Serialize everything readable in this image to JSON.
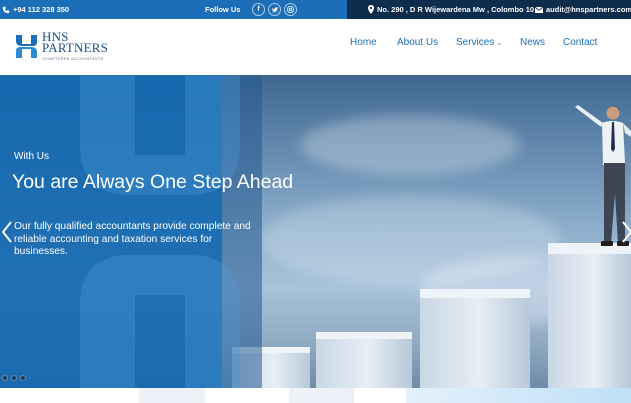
{
  "topbar": {
    "phone": "+94 112 328 350",
    "follow_label": "Follow Us",
    "social": [
      "facebook-icon",
      "twitter-icon",
      "instagram-icon"
    ],
    "address": "No. 290 , D R Wijewardena Mw , Colombo 10",
    "email": "audit@hnspartners.com"
  },
  "brand": {
    "name_line1": "HNS",
    "name_line2": "PARTNERS",
    "tagline": "CHARTERED ACCOUNTANTS"
  },
  "nav": [
    {
      "label": "Home"
    },
    {
      "label": "About Us"
    },
    {
      "label": "Services"
    },
    {
      "label": "News"
    },
    {
      "label": "Contact"
    }
  ],
  "hero": {
    "eyebrow": "With Us",
    "headline": "You are Always One Step Ahead",
    "description": "Our fully qualified accountants provide complete and reliable accounting and taxation services for businesses.",
    "slide_count": 3
  },
  "colors": {
    "primary": "#1c6eb8",
    "dark": "#0e2c4c",
    "logo": "#1b4f8a"
  }
}
